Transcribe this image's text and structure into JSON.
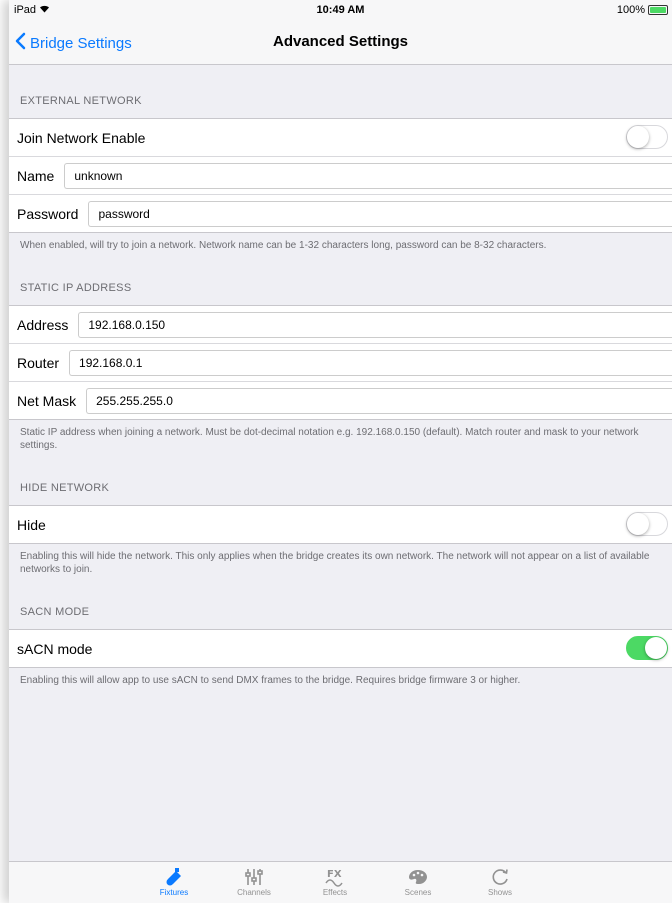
{
  "status": {
    "device": "iPad",
    "time": "10:49 AM",
    "battery": "100%"
  },
  "nav": {
    "back_label": "Bridge Settings",
    "title": "Advanced Settings"
  },
  "external": {
    "header": "EXTERNAL NETWORK",
    "join_label": "Join Network Enable",
    "join_on": false,
    "name_label": "Name",
    "name_value": "unknown",
    "password_label": "Password",
    "password_value": "password",
    "note": "When enabled, will try to join a network. Network name can be 1-32 characters long, password can be 8-32 characters."
  },
  "static_ip": {
    "header": "STATIC IP ADDRESS",
    "address_label": "Address",
    "address_value": "192.168.0.150",
    "router_label": "Router",
    "router_value": "192.168.0.1",
    "mask_label": "Net Mask",
    "mask_value": "255.255.255.0",
    "note": "Static IP address when joining a network. Must be dot-decimal notation e.g. 192.168.0.150 (default). Match router and mask to your network settings."
  },
  "hide": {
    "header": "HIDE NETWORK",
    "label": "Hide",
    "on": false,
    "note": "Enabling this will hide the network. This only applies when the bridge creates its own network. The network will not appear on a list of available networks to join."
  },
  "sacn": {
    "header": "SACN MODE",
    "label": "sACN mode",
    "on": true,
    "note": "Enabling this will allow app to use sACN to send DMX frames to the bridge. Requires bridge firmware 3 or higher."
  },
  "tabs": [
    {
      "label": "Fixtures",
      "icon": "fixtures-icon",
      "active": true
    },
    {
      "label": "Channels",
      "icon": "channels-icon",
      "active": false
    },
    {
      "label": "Effects",
      "icon": "effects-icon",
      "active": false
    },
    {
      "label": "Scenes",
      "icon": "scenes-icon",
      "active": false
    },
    {
      "label": "Shows",
      "icon": "shows-icon",
      "active": false
    }
  ],
  "colors": {
    "accent": "#0a7aff",
    "toggle_on": "#4cd964",
    "background": "#efeff4"
  }
}
